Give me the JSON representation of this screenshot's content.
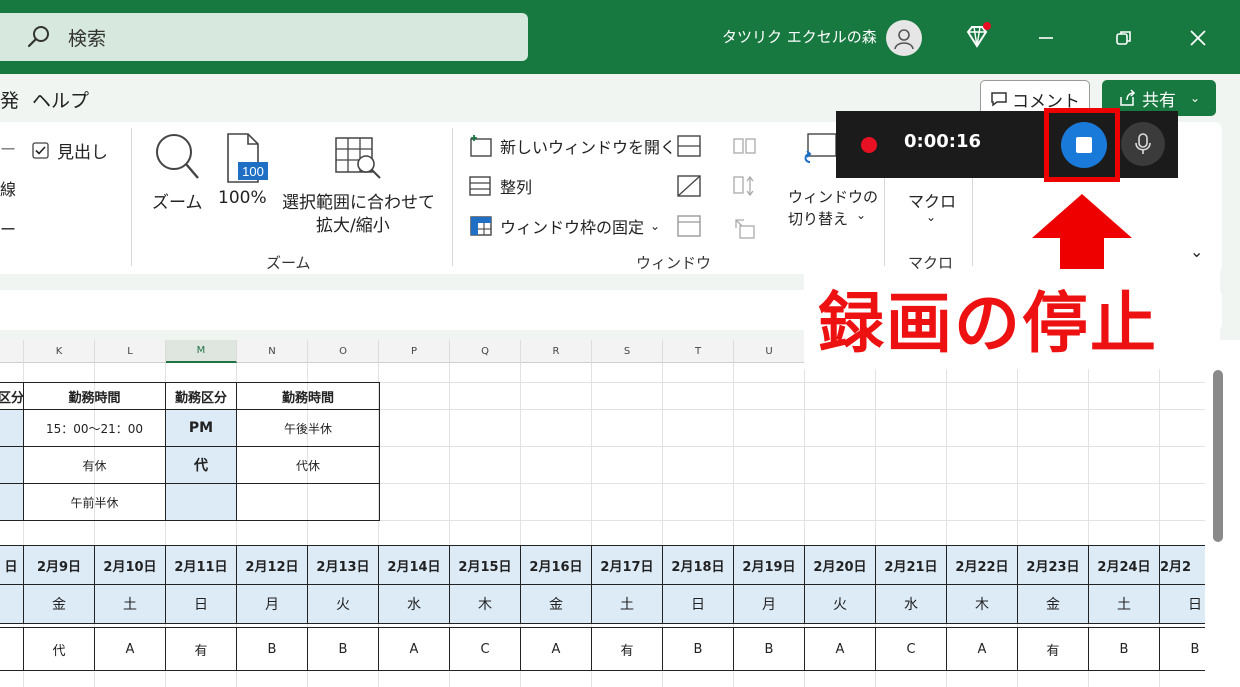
{
  "titlebar": {
    "search_placeholder": "検索",
    "user_name": "タツリク エクセルの森"
  },
  "menu": {
    "partial": "発",
    "help": "ヘルプ",
    "comment": "コメント",
    "share": "共有"
  },
  "ribbon": {
    "left_partial": {
      "a": "ー",
      "b": "線",
      "c": "ー"
    },
    "headings_checkbox": "見出し",
    "zoom_group": {
      "zoom": "ズーム",
      "hundred": "100%",
      "fit_line1": "選択範囲に合わせて",
      "fit_line2": "拡大/縮小",
      "label": "ズーム"
    },
    "window_group": {
      "new_window": "新しいウィンドウを開く",
      "arrange": "整列",
      "freeze": "ウィンドウ枠の固定",
      "switch_line1": "ウィンドウの",
      "switch_line2": "切り替え",
      "label": "ウィンドウ"
    },
    "macro_group": {
      "macro": "マクロ",
      "label": "マクロ"
    }
  },
  "recorder": {
    "time": "0:00:16"
  },
  "callout": "録画の停止",
  "sheet": {
    "columns": [
      "K",
      "L",
      "M",
      "N",
      "O",
      "P",
      "Q",
      "R",
      "S",
      "T",
      "U"
    ],
    "legend": {
      "h1": "区分",
      "h2": "勤務時間",
      "h3": "勤務区分",
      "h4": "勤務時間",
      "r1c2": "15：00～21：00",
      "r1c3": "PM",
      "r1c4": "午後半休",
      "r2c2": "有休",
      "r2c3": "代",
      "r2c4": "代休",
      "r3c2": "午前半休"
    },
    "dates": [
      "日",
      "2月9日",
      "2月10日",
      "2月11日",
      "2月12日",
      "2月13日",
      "2月14日",
      "2月15日",
      "2月16日",
      "2月17日",
      "2月18日",
      "2月19日",
      "2月20日",
      "2月21日",
      "2月22日",
      "2月23日",
      "2月24日",
      "2月2"
    ],
    "weekdays": [
      "",
      "金",
      "土",
      "日",
      "月",
      "火",
      "水",
      "木",
      "金",
      "土",
      "日",
      "月",
      "火",
      "水",
      "木",
      "金",
      "土",
      "日"
    ],
    "shifts": [
      "",
      "代",
      "A",
      "有",
      "B",
      "B",
      "A",
      "C",
      "A",
      "有",
      "B",
      "B",
      "A",
      "C",
      "A",
      "有",
      "B",
      "B"
    ]
  }
}
